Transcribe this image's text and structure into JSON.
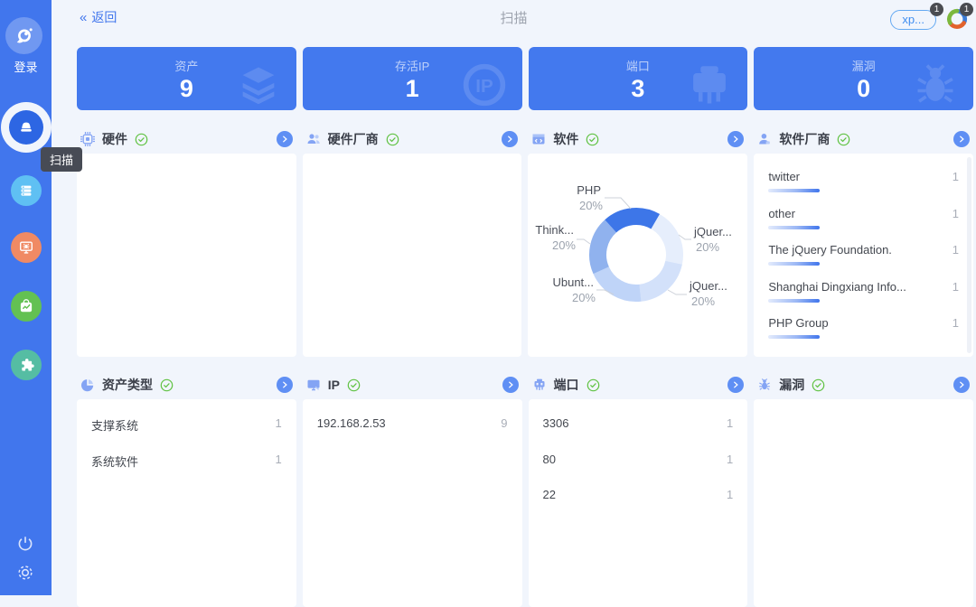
{
  "header": {
    "back_arrows": "«",
    "back_label": "返回",
    "title": "扫描",
    "user_pill": "xp...",
    "user_pill_badge": "1",
    "corner_logo_badge": "1"
  },
  "sidebar": {
    "login_label": "登录",
    "active_tooltip": "扫描",
    "items": [
      "scan",
      "assets",
      "vulnerability",
      "report",
      "plugin"
    ]
  },
  "stats": [
    {
      "label": "资产",
      "value": "9",
      "icon": "layers-icon"
    },
    {
      "label": "存活IP",
      "value": "1",
      "icon": "ip-icon"
    },
    {
      "label": "端口",
      "value": "3",
      "icon": "port-icon"
    },
    {
      "label": "漏洞",
      "value": "0",
      "icon": "bug-icon"
    }
  ],
  "panels": {
    "hardware": {
      "title": "硬件",
      "icon": "chip-icon"
    },
    "hardware_vendor": {
      "title": "硬件厂商",
      "icon": "group-icon"
    },
    "software": {
      "title": "软件",
      "icon": "window-code-icon"
    },
    "software_vendor": {
      "title": "软件厂商",
      "icon": "person-icon",
      "items": [
        {
          "label": "twitter",
          "value": "1"
        },
        {
          "label": "other",
          "value": "1"
        },
        {
          "label": "The jQuery Foundation.",
          "value": "1"
        },
        {
          "label": "Shanghai Dingxiang Info...",
          "value": "1"
        },
        {
          "label": "PHP Group",
          "value": "1"
        }
      ]
    },
    "asset_type": {
      "title": "资产类型",
      "icon": "pie-icon",
      "items": [
        {
          "label": "支撑系统",
          "value": "1"
        },
        {
          "label": "系统软件",
          "value": "1"
        }
      ]
    },
    "ip": {
      "title": "IP",
      "icon": "monitor-icon",
      "items": [
        {
          "label": "192.168.2.53",
          "value": "9"
        }
      ]
    },
    "port": {
      "title": "端口",
      "icon": "plug-icon",
      "items": [
        {
          "label": "3306",
          "value": "1"
        },
        {
          "label": "80",
          "value": "1"
        },
        {
          "label": "22",
          "value": "1"
        }
      ]
    },
    "vuln": {
      "title": "漏洞",
      "icon": "bug-icon"
    }
  },
  "chart_data": {
    "type": "pie",
    "donut": true,
    "start_angle_deg": -42,
    "slices": [
      {
        "name": "PHP",
        "pct": "20%",
        "value": 20,
        "color": "#3d76e8"
      },
      {
        "name": "jQuer...",
        "pct": "20%",
        "value": 20,
        "color": "#e6eefc"
      },
      {
        "name": "jQuer...",
        "pct": "20%",
        "value": 20,
        "color": "#d3e1fa"
      },
      {
        "name": "Ubunt...",
        "pct": "20%",
        "value": 20,
        "color": "#bfd4f8"
      },
      {
        "name": "Think...",
        "pct": "20%",
        "value": 20,
        "color": "#90b2ee"
      }
    ]
  },
  "colors": {
    "sidebar": "#4176ed",
    "card": "#4379ee",
    "accent": "#4075ec",
    "check_green": "#5fc242",
    "page_bg": "#f1f5fc"
  }
}
